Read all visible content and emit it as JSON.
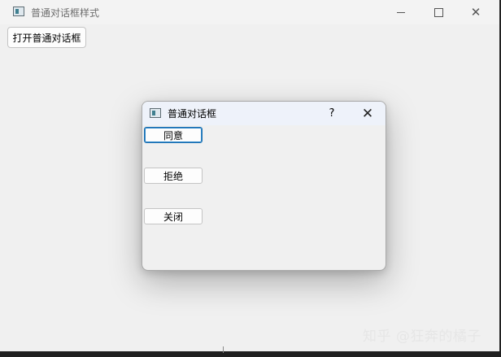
{
  "window": {
    "title": "普通对话框样式",
    "controls": {
      "minimize": "–",
      "maximize": "□",
      "close": "✕"
    }
  },
  "toolbar": {
    "open_dialog_label": "打开普通对话框"
  },
  "dialog": {
    "title": "普通对话框",
    "help_label": "?",
    "close_label": "✕",
    "buttons": {
      "agree": "同意",
      "reject": "拒绝",
      "close": "关闭"
    }
  },
  "watermark": "知乎 @狂奔的橘子",
  "icons": {
    "app": "app-window-icon"
  },
  "colors": {
    "focus_border": "#1c6fb0",
    "dialog_titlebar": "#eef2fa",
    "window_bg": "#f0f0f0"
  }
}
